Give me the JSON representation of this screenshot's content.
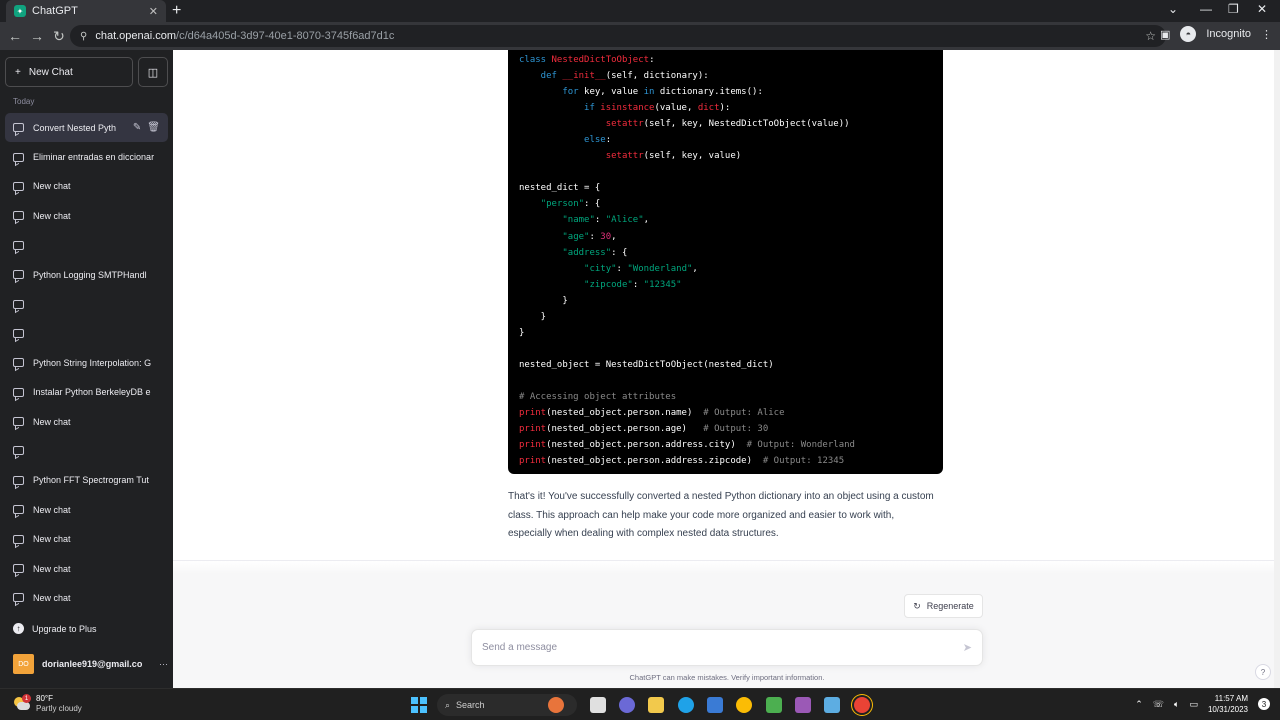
{
  "browser": {
    "tab_title": "ChatGPT",
    "tab_close": "✕",
    "new_tab": "+",
    "url_host": "chat.openai.com",
    "url_path": "/c/d64a405d-3d97-40e1-8070-3745f6ad7d1c",
    "profile_label": "Incognito"
  },
  "sidebar": {
    "new_chat_label": "New Chat",
    "section_today": "Today",
    "chats": [
      {
        "label": "Convert Nested Pyth",
        "active": true
      },
      {
        "label": "Eliminar entradas en diccionar",
        "active": false
      },
      {
        "label": "New chat",
        "active": false
      },
      {
        "label": "New chat",
        "active": false
      },
      {
        "label": "",
        "active": false
      },
      {
        "label": "Python Logging SMTPHandl",
        "active": false
      },
      {
        "label": "",
        "active": false
      },
      {
        "label": "",
        "active": false
      },
      {
        "label": "Python String Interpolation: G",
        "active": false
      },
      {
        "label": "Instalar Python BerkeleyDB e",
        "active": false
      },
      {
        "label": "New chat",
        "active": false
      },
      {
        "label": "",
        "active": false
      },
      {
        "label": "Python FFT Spectrogram Tut",
        "active": false
      },
      {
        "label": "New chat",
        "active": false
      },
      {
        "label": "New chat",
        "active": false
      },
      {
        "label": "New chat",
        "active": false
      },
      {
        "label": "New chat",
        "active": false
      }
    ],
    "upgrade_label": "Upgrade to Plus",
    "user_initials": "DO",
    "user_email": "dorianlee919@gmail.co",
    "user_more": "···"
  },
  "conversation": {
    "code_lines": [
      [
        {
          "t": "class ",
          "c": "kw"
        },
        {
          "t": "NestedDictToObject",
          "c": "fn"
        },
        {
          "t": ":",
          "c": ""
        }
      ],
      [
        {
          "t": "    def ",
          "c": "kw"
        },
        {
          "t": "__init__",
          "c": "fn"
        },
        {
          "t": "(self, dictionary):",
          "c": ""
        }
      ],
      [
        {
          "t": "        for ",
          "c": "kw"
        },
        {
          "t": "key, value ",
          "c": ""
        },
        {
          "t": "in ",
          "c": "kw"
        },
        {
          "t": "dictionary.items():",
          "c": ""
        }
      ],
      [
        {
          "t": "            if ",
          "c": "kw"
        },
        {
          "t": "isinstance",
          "c": "fn"
        },
        {
          "t": "(value, ",
          "c": ""
        },
        {
          "t": "dict",
          "c": "fn"
        },
        {
          "t": "):",
          "c": ""
        }
      ],
      [
        {
          "t": "                ",
          "c": ""
        },
        {
          "t": "setattr",
          "c": "fn"
        },
        {
          "t": "(self, key, NestedDictToObject(value))",
          "c": ""
        }
      ],
      [
        {
          "t": "            else",
          "c": "kw"
        },
        {
          "t": ":",
          "c": ""
        }
      ],
      [
        {
          "t": "                ",
          "c": ""
        },
        {
          "t": "setattr",
          "c": "fn"
        },
        {
          "t": "(self, key, value)",
          "c": ""
        }
      ],
      [
        {
          "t": "",
          "c": ""
        }
      ],
      [
        {
          "t": "nested_dict = {",
          "c": ""
        }
      ],
      [
        {
          "t": "    ",
          "c": ""
        },
        {
          "t": "\"person\"",
          "c": "str"
        },
        {
          "t": ": {",
          "c": ""
        }
      ],
      [
        {
          "t": "        ",
          "c": ""
        },
        {
          "t": "\"name\"",
          "c": "str"
        },
        {
          "t": ": ",
          "c": ""
        },
        {
          "t": "\"Alice\"",
          "c": "str"
        },
        {
          "t": ",",
          "c": ""
        }
      ],
      [
        {
          "t": "        ",
          "c": ""
        },
        {
          "t": "\"age\"",
          "c": "str"
        },
        {
          "t": ": ",
          "c": ""
        },
        {
          "t": "30",
          "c": "num"
        },
        {
          "t": ",",
          "c": ""
        }
      ],
      [
        {
          "t": "        ",
          "c": ""
        },
        {
          "t": "\"address\"",
          "c": "str"
        },
        {
          "t": ": {",
          "c": ""
        }
      ],
      [
        {
          "t": "            ",
          "c": ""
        },
        {
          "t": "\"city\"",
          "c": "str"
        },
        {
          "t": ": ",
          "c": ""
        },
        {
          "t": "\"Wonderland\"",
          "c": "str"
        },
        {
          "t": ",",
          "c": ""
        }
      ],
      [
        {
          "t": "            ",
          "c": ""
        },
        {
          "t": "\"zipcode\"",
          "c": "str"
        },
        {
          "t": ": ",
          "c": ""
        },
        {
          "t": "\"12345\"",
          "c": "str"
        }
      ],
      [
        {
          "t": "        }",
          "c": ""
        }
      ],
      [
        {
          "t": "    }",
          "c": ""
        }
      ],
      [
        {
          "t": "}",
          "c": ""
        }
      ],
      [
        {
          "t": "",
          "c": ""
        }
      ],
      [
        {
          "t": "nested_object = NestedDictToObject(nested_dict)",
          "c": ""
        }
      ],
      [
        {
          "t": "",
          "c": ""
        }
      ],
      [
        {
          "t": "# Accessing object attributes",
          "c": "cm"
        }
      ],
      [
        {
          "t": "print",
          "c": "fn"
        },
        {
          "t": "(nested_object.person.name)  ",
          "c": ""
        },
        {
          "t": "# Output: Alice",
          "c": "cm"
        }
      ],
      [
        {
          "t": "print",
          "c": "fn"
        },
        {
          "t": "(nested_object.person.age)   ",
          "c": ""
        },
        {
          "t": "# Output: 30",
          "c": "cm"
        }
      ],
      [
        {
          "t": "print",
          "c": "fn"
        },
        {
          "t": "(nested_object.person.address.city)  ",
          "c": ""
        },
        {
          "t": "# Output: Wonderland",
          "c": "cm"
        }
      ],
      [
        {
          "t": "print",
          "c": "fn"
        },
        {
          "t": "(nested_object.person.address.zipcode)  ",
          "c": ""
        },
        {
          "t": "# Output: 12345",
          "c": "cm"
        }
      ]
    ],
    "answer_text": "That's it! You've successfully converted a nested Python dictionary into an object using a custom class. This approach can help make your code more organized and easier to work with, especially when dealing with complex nested data structures.",
    "regenerate_label": "Regenerate",
    "input_placeholder": "Send a message",
    "disclaimer": "ChatGPT can make mistakes. Verify important information.",
    "help_label": "?"
  },
  "taskbar": {
    "weather_temp": "80°F",
    "weather_desc": "Partly cloudy",
    "weather_badge": "1",
    "search_label": "Search",
    "time": "11:57 AM",
    "date": "10/31/2023",
    "notifications": "3"
  },
  "colors": {
    "sidebar_bg": "#202123",
    "code_bg": "#000000",
    "accent": "#10a37f"
  }
}
